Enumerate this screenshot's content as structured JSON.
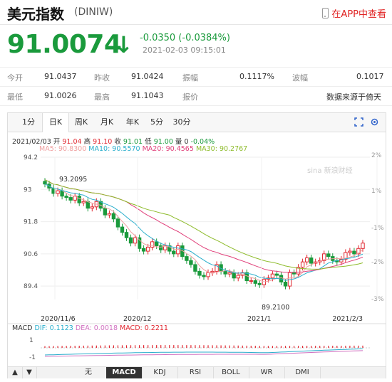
{
  "header": {
    "title": "美元指数",
    "code": "(DINIW)",
    "app_link": "在APP中查看"
  },
  "quote": {
    "price": "91.0074",
    "change": "-0.0350 (-0.0384%)",
    "time": "2021-02-03 09:15:01"
  },
  "stats": [
    [
      {
        "label": "今开",
        "value": "91.0437"
      },
      {
        "label": "昨收",
        "value": "91.0424"
      },
      {
        "label": "振幅",
        "value": "0.1117%"
      },
      {
        "label": "波幅",
        "value": "0.1017"
      }
    ],
    [
      {
        "label": "最低",
        "value": "91.0026"
      },
      {
        "label": "最高",
        "value": "91.1043"
      },
      {
        "label": "报价",
        "value": ""
      },
      {
        "label": "",
        "value": "数据来源于倚天"
      }
    ]
  ],
  "tabs": [
    "1分",
    "日K",
    "周K",
    "月K",
    "年K",
    "5分",
    "30分"
  ],
  "ohlc": {
    "date": "2021/02/03",
    "open_label": "开",
    "open": "91.04",
    "high_label": "高",
    "high": "91.10",
    "close_label": "收",
    "close": "91.01",
    "low_label": "低",
    "low": "91.00",
    "vol_label": "量",
    "vol": "0",
    "pct": "-0.04%"
  },
  "ma": [
    {
      "text": "MA5: 90.8300",
      "color": "#f0a0a0"
    },
    {
      "text": "MA10: 90.5570",
      "color": "#2aaecc"
    },
    {
      "text": "MA20: 90.4565",
      "color": "#e0407a"
    },
    {
      "text": "MA30: 90.2767",
      "color": "#8dbb2a"
    }
  ],
  "watermark": "新浪财经",
  "chart_data": {
    "type": "candlestick",
    "y_ticks": [
      "94.2",
      "93",
      "91.8",
      "90.6",
      "89.4"
    ],
    "pct_ticks": [
      "2%",
      "1%",
      "-1%",
      "-2%",
      "-3%"
    ],
    "x_ticks": [
      "2020/11/6",
      "2020/12",
      "2021/1",
      "2021/2/3"
    ],
    "annotations": [
      {
        "text": "93.2095",
        "kind": "high"
      },
      {
        "text": "89.2100",
        "kind": "low"
      }
    ],
    "ylim": [
      88.9,
      94.2
    ],
    "close": [
      93.2,
      93.05,
      92.85,
      92.95,
      92.75,
      92.7,
      92.6,
      92.75,
      92.5,
      92.55,
      92.3,
      92.35,
      92.55,
      92.3,
      92.05,
      92.1,
      91.9,
      91.6,
      91.4,
      91.2,
      91.0,
      91.2,
      90.8,
      90.7,
      90.85,
      91.05,
      90.9,
      90.75,
      90.9,
      90.7,
      90.6,
      90.9,
      90.5,
      90.35,
      90.2,
      89.95,
      89.8,
      89.75,
      89.9,
      89.95,
      90.2,
      89.95,
      89.85,
      89.9,
      89.7,
      89.8,
      89.9,
      89.6,
      89.6,
      89.5,
      89.45,
      89.65,
      89.7,
      89.85,
      89.8,
      89.55,
      89.4,
      89.9,
      89.85,
      90.1,
      90.3,
      90.45,
      90.25,
      90.3,
      90.35,
      90.6,
      90.5,
      90.35,
      90.3,
      90.4,
      90.65,
      90.7,
      90.6,
      90.8,
      91.0
    ],
    "macd": {
      "DIF": "0.1123",
      "DEA": "0.0018",
      "MACD": "0.2211",
      "y_ticks": [
        "1",
        "-1"
      ]
    }
  },
  "bottom_tabs": [
    "▲",
    "▼",
    "无",
    "MACD",
    "KDJ",
    "RSI",
    "BOLL",
    "WR",
    "DMI"
  ]
}
